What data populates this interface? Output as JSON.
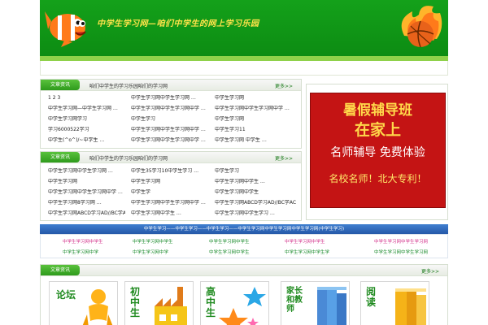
{
  "header": {
    "site_title": "中学生学习网—咱们中学生的网上学习乐园"
  },
  "panel1": {
    "tag": "文章资讯",
    "title": "咱们中学生的学习乐园咱们的学习网",
    "more": "更多>>",
    "rows": [
      [
        "1 2 3",
        "中学生学习网中学生学习网 …",
        "中学生学习网"
      ],
      [
        "中学生学习网—中学生学习网 …",
        "中学生学习网中学生学习网中学 …",
        "中学生学习网中学生学习网中学 …"
      ],
      [
        "中学生学习网学习",
        "中学生学习",
        "中学生学习网"
      ],
      [
        "学习6000522学习",
        "中学生学习网中学生学习网中学 …",
        "中学生学习11"
      ],
      [
        "中学生(^o^)/~中学生 …",
        "中学生学习网中学生学习网中学 …",
        "中学生学习网 中学生 …"
      ]
    ]
  },
  "panel2": {
    "tag": "文章资讯",
    "title": "咱们中学生的学习乐园咱们的学习网",
    "more": "更多>>",
    "rows": [
      [
        "中学生学习网中学生学习网 …",
        "中学生35学习10中学生学习 …",
        "中学生学习"
      ],
      [
        "中学生学习网",
        "中学生学习网",
        "中学生学习网中学生 …"
      ],
      [
        "中学生学习网中学生学习网中学 …",
        "中学生学",
        "中学生学习网中学生"
      ],
      [
        "中学生学习网8学习网 …",
        "中学生学习网中学生学习网中学 …",
        "中学生学习网ABCD学习AD//BC学AC ⊥ …"
      ],
      [
        "中学生学习网ABCD学习AD//BC学AC …",
        "中学生学习网中学生 …",
        "中学生学习网中学生学习 …"
      ]
    ]
  },
  "ad": {
    "line1": "暑假辅导班",
    "line2": "在家上",
    "line3": "名师辅导  免费体验",
    "line4": "名校名师！北大专利！"
  },
  "bluebar": {
    "text": "中学生学习——中学生学习——中学生学习——中学生学习网中学生学习网中学生学习网(中学生学习)"
  },
  "links": {
    "row1": [
      "中学生学习网中学生",
      "中学生学习网中学生",
      "中学生学习网中学生",
      "中学生学习网中学生",
      "中学生学习网中学生学习网"
    ],
    "row2": [
      "中学生学习网中学",
      "中学生学习网中学",
      "中学生学习网中学生",
      "中学生学习网中学生学",
      "中学生学习网中学生学习网"
    ]
  },
  "bottom": {
    "tag": "文章资讯",
    "more": "更多>>",
    "tiles": [
      {
        "label": "论坛",
        "icon": "forum-person-icon"
      },
      {
        "label": "初中生",
        "icon": "factory-icon"
      },
      {
        "label": "高中生",
        "icon": "stars-icon"
      },
      {
        "label": "家长和教师",
        "icon": "books-icon"
      },
      {
        "label": "阅读",
        "icon": "reading-books-icon"
      }
    ]
  },
  "colors": {
    "header_green": "#14a11a",
    "ad_red": "#c41414",
    "bluebar": "#2558a8",
    "link_pink": "#d2308a",
    "link_green": "#188a2a"
  }
}
